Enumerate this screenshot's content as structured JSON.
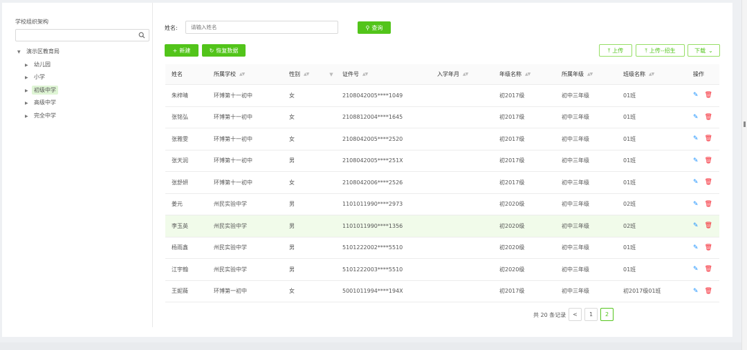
{
  "tree": {
    "title": "学校组织架构",
    "root": "演示区教育局",
    "children": [
      "幼儿园",
      "小学",
      "初级中学",
      "高级中学",
      "完全中学"
    ],
    "selected_index": 2
  },
  "search": {
    "label": "姓名:",
    "placeholder": "请输入姓名",
    "query_button": "查询"
  },
  "toolbar": {
    "new_button": "新建",
    "restore_button": "恢复数据",
    "upload_button": "上传",
    "upload_enroll_button": "上传--招生",
    "download_button": "下载"
  },
  "table": {
    "headers": [
      "姓名",
      "所属学校",
      "性别",
      "证件号",
      "入学年月",
      "年级名称",
      "所属年级",
      "班级名称",
      "操作"
    ],
    "rows": [
      [
        "朱梓晴",
        "环博第十一初中",
        "女",
        "2108042005****1049",
        "",
        "初2017级",
        "初中三年级",
        "01班"
      ],
      [
        "张铭弘",
        "环博第十一初中",
        "女",
        "2108812004****1645",
        "",
        "初2017级",
        "初中三年级",
        "01班"
      ],
      [
        "张雅雯",
        "环博第十一初中",
        "女",
        "2108042005****2520",
        "",
        "初2017级",
        "初中三年级",
        "01班"
      ],
      [
        "张天润",
        "环博第十一初中",
        "男",
        "2108042005****251X",
        "",
        "初2017级",
        "初中三年级",
        "01班"
      ],
      [
        "张舒妍",
        "环博第十一初中",
        "女",
        "2108042006****2526",
        "",
        "初2017级",
        "初中三年级",
        "01班"
      ],
      [
        "姜元",
        "州民实验中学",
        "男",
        "1101011990****2973",
        "",
        "初2020级",
        "初中三年级",
        "02班"
      ],
      [
        "李玉英",
        "州民实验中学",
        "男",
        "1101011990****1356",
        "",
        "初2020级",
        "初中三年级",
        "02班"
      ],
      [
        "杨雨鑫",
        "州民实验中学",
        "男",
        "5101222002****5510",
        "",
        "初2020级",
        "初中三年级",
        "01班"
      ],
      [
        "江宇翰",
        "州民实验中学",
        "男",
        "5101222003****5510",
        "",
        "初2020级",
        "初中三年级",
        "01班"
      ],
      [
        "王妮薇",
        "环博第一初中",
        "女",
        "5001011994****194X",
        "",
        "初2017级",
        "初中三年级",
        "初2017级01班"
      ]
    ],
    "highlighted_row": 6
  },
  "pagination": {
    "total_text": "共 20 条记录",
    "prev": "<",
    "pages": [
      "1",
      "2"
    ],
    "current": "2"
  },
  "colors": {
    "primary": "#52c41a",
    "edit": "#1890ff",
    "delete": "#f5222d"
  }
}
